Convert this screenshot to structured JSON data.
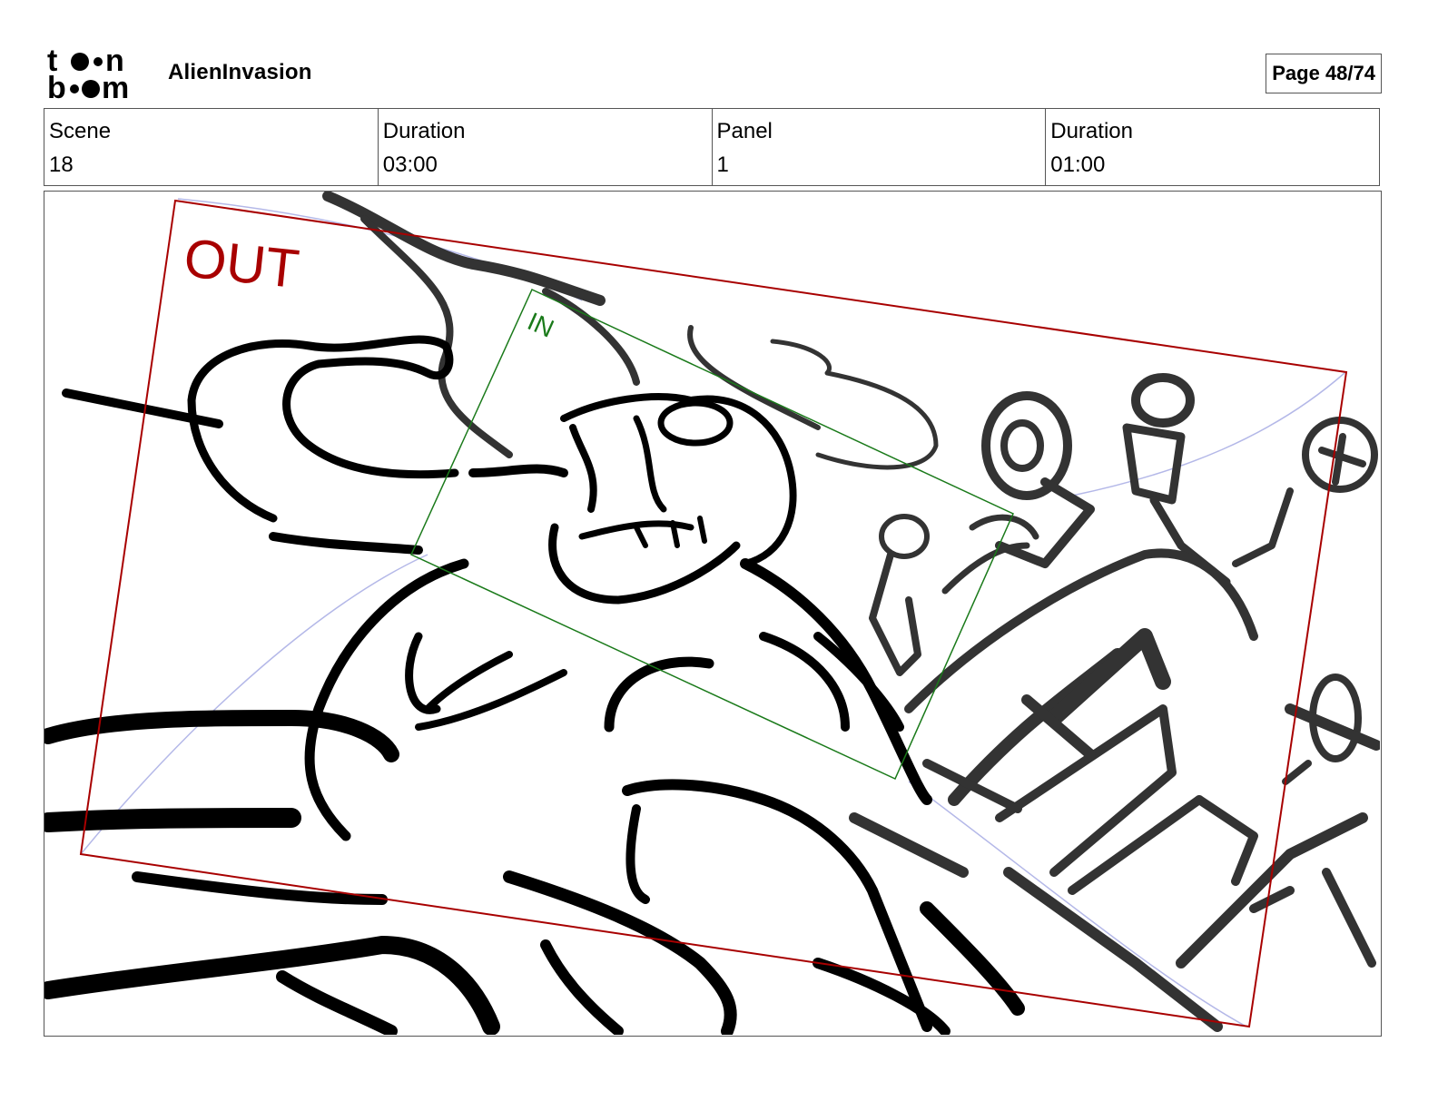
{
  "header": {
    "logo_line1": "toon",
    "logo_line2": "boom",
    "project_title": "AlienInvasion",
    "page_label": "Page 48/74"
  },
  "info": [
    {
      "label": "Scene",
      "value": "18"
    },
    {
      "label": "Duration",
      "value": "03:00"
    },
    {
      "label": "Panel",
      "value": "1"
    },
    {
      "label": "Duration",
      "value": "01:00"
    }
  ],
  "panel": {
    "out_label": "OUT",
    "in_label": "IN",
    "colors": {
      "out_frame": "#a80000",
      "in_frame": "#1a7a1a",
      "guide": "#b4b8e8",
      "ink": "#000000",
      "ink_bg": "#333333"
    }
  }
}
